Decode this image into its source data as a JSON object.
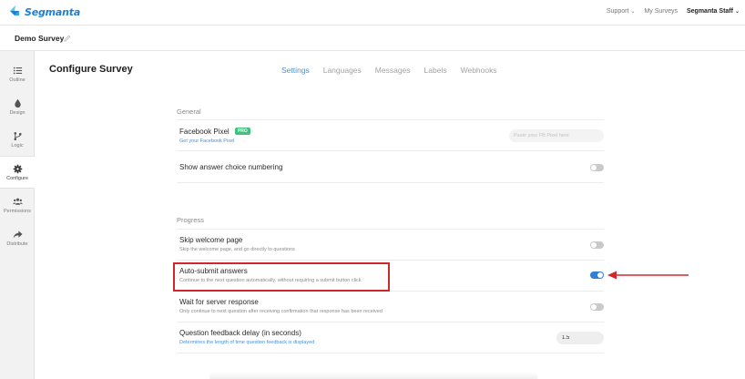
{
  "brand": {
    "name": "Segmanta"
  },
  "topnav": {
    "support": "Support",
    "my_surveys": "My Surveys",
    "account": "Segmanta Staff"
  },
  "survey": {
    "name": "Demo Survey"
  },
  "sidebar": {
    "items": [
      {
        "label": "Outline",
        "icon": "list-icon"
      },
      {
        "label": "Design",
        "icon": "drop-icon"
      },
      {
        "label": "Logic",
        "icon": "branch-icon"
      },
      {
        "label": "Configure",
        "icon": "gear-icon",
        "active": true
      },
      {
        "label": "Permissions",
        "icon": "users-icon"
      },
      {
        "label": "Distribute",
        "icon": "share-icon"
      }
    ]
  },
  "main": {
    "title": "Configure Survey",
    "tabs": [
      {
        "label": "Settings",
        "active": true
      },
      {
        "label": "Languages"
      },
      {
        "label": "Messages"
      },
      {
        "label": "Labels"
      },
      {
        "label": "Webhooks"
      }
    ]
  },
  "general": {
    "title": "General",
    "facebook_pixel": {
      "title": "Facebook Pixel",
      "badge": "PRO",
      "link": "Get your Facebook Pixel",
      "placeholder": "Paste your FB Pixel here"
    },
    "answer_numbering": {
      "title": "Show answer choice numbering",
      "enabled": false
    }
  },
  "progress": {
    "title": "Progress",
    "skip_welcome": {
      "title": "Skip welcome page",
      "desc": "Skip the welcome page, and go directly to questions",
      "enabled": false
    },
    "auto_submit": {
      "title": "Auto-submit answers",
      "desc": "Continue to the next question automatically, without requiring a submit button click",
      "enabled": true
    },
    "wait_server": {
      "title": "Wait for server response",
      "desc": "Only continue to next question after receiving confirmation that response has been received",
      "enabled": false
    },
    "feedback_delay": {
      "title": "Question feedback delay (in seconds)",
      "desc": "Determines the length of time question feedback is displayed",
      "value": "1.5"
    }
  },
  "colors": {
    "accent": "#4a90d9",
    "toggle_on": "#2d7fd8",
    "annotation": "#d0282a",
    "pro_badge": "#3fc27d"
  }
}
